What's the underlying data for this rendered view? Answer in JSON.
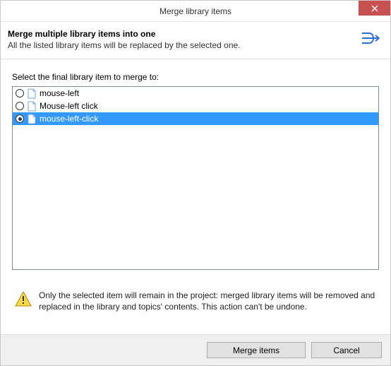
{
  "window": {
    "title": "Merge library items"
  },
  "header": {
    "title": "Merge multiple library items into one",
    "subtitle": "All the listed library items will be replaced by the selected one."
  },
  "list": {
    "label": "Select the final library item to merge to:",
    "items": [
      {
        "label": "mouse-left",
        "selected": false
      },
      {
        "label": "Mouse-left click",
        "selected": false
      },
      {
        "label": "mouse-left-click",
        "selected": true
      }
    ]
  },
  "warning": {
    "text": "Only the selected item will remain in the project: merged library items will be removed and replaced in the library and topics' contents. This action can't be undone."
  },
  "buttons": {
    "merge": "Merge items",
    "cancel": "Cancel"
  }
}
